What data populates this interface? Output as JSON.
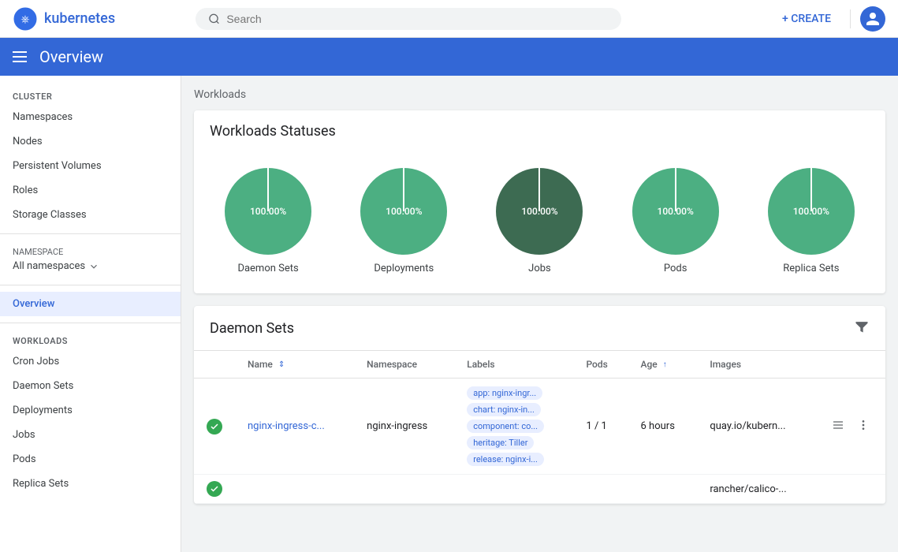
{
  "topbar": {
    "logo_text": "kubernetes",
    "search_placeholder": "Search",
    "create_label": "+ CREATE",
    "divider": true
  },
  "header": {
    "title": "Overview"
  },
  "sidebar": {
    "cluster_label": "Cluster",
    "items_cluster": [
      {
        "label": "Namespaces",
        "id": "namespaces",
        "active": false
      },
      {
        "label": "Nodes",
        "id": "nodes",
        "active": false
      },
      {
        "label": "Persistent Volumes",
        "id": "persistent-volumes",
        "active": false
      },
      {
        "label": "Roles",
        "id": "roles",
        "active": false
      },
      {
        "label": "Storage Classes",
        "id": "storage-classes",
        "active": false
      }
    ],
    "namespace_label": "Namespace",
    "namespace_value": "All namespaces",
    "items_nav": [
      {
        "label": "Overview",
        "id": "overview",
        "active": true
      }
    ],
    "workloads_label": "Workloads",
    "items_workloads": [
      {
        "label": "Cron Jobs",
        "id": "cron-jobs",
        "active": false
      },
      {
        "label": "Daemon Sets",
        "id": "daemon-sets",
        "active": false
      },
      {
        "label": "Deployments",
        "id": "deployments",
        "active": false
      },
      {
        "label": "Jobs",
        "id": "jobs",
        "active": false
      },
      {
        "label": "Pods",
        "id": "pods",
        "active": false
      },
      {
        "label": "Replica Sets",
        "id": "replica-sets",
        "active": false
      }
    ]
  },
  "main": {
    "page_label": "Workloads",
    "statuses_card": {
      "title": "Workloads Statuses",
      "items": [
        {
          "label": "Daemon Sets",
          "percentage": "100.00%",
          "color": "#4caf82",
          "dark": false
        },
        {
          "label": "Deployments",
          "percentage": "100.00%",
          "color": "#4caf82",
          "dark": false
        },
        {
          "label": "Jobs",
          "percentage": "100.00%",
          "color": "#3d6b52",
          "dark": true
        },
        {
          "label": "Pods",
          "percentage": "100.00%",
          "color": "#4caf82",
          "dark": false
        },
        {
          "label": "Replica Sets",
          "percentage": "100.00%",
          "color": "#4caf82",
          "dark": false
        }
      ]
    },
    "daemon_sets_card": {
      "title": "Daemon Sets",
      "columns": [
        {
          "label": "Name",
          "id": "name",
          "sortable": true,
          "sort_active": false
        },
        {
          "label": "Namespace",
          "id": "namespace",
          "sortable": false
        },
        {
          "label": "Labels",
          "id": "labels",
          "sortable": false
        },
        {
          "label": "Pods",
          "id": "pods",
          "sortable": false
        },
        {
          "label": "Age",
          "id": "age",
          "sortable": true,
          "sort_active": true
        },
        {
          "label": "Images",
          "id": "images",
          "sortable": false
        }
      ],
      "rows": [
        {
          "status": "success",
          "name": "nginx-ingress-c...",
          "namespace": "nginx-ingress",
          "labels": [
            "app: nginx-ingr...",
            "chart: nginx-in...",
            "component: co...",
            "heritage: Tiller",
            "release: nginx-i..."
          ],
          "pods": "1 / 1",
          "age": "6 hours",
          "images": "quay.io/kubern..."
        },
        {
          "status": "success",
          "name": "",
          "namespace": "",
          "labels": [],
          "pods": "",
          "age": "",
          "images": "rancher/calico-..."
        }
      ]
    }
  }
}
